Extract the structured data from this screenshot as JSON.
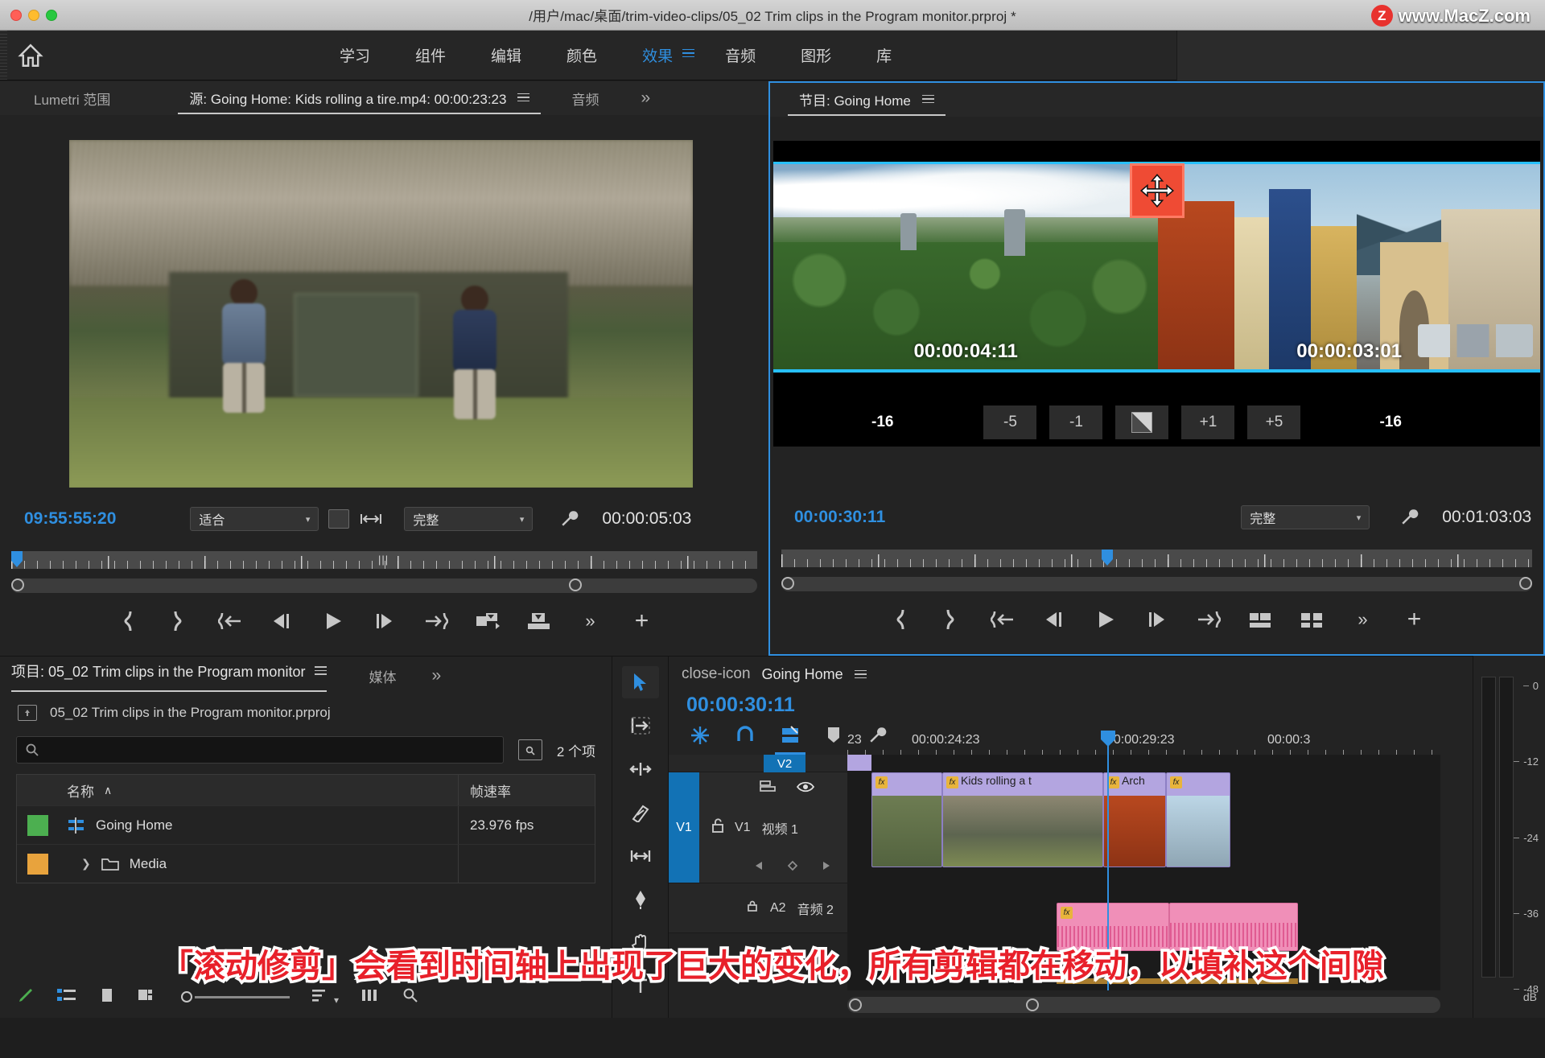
{
  "titlebar": {
    "path": "/用户/mac/桌面/trim-video-clips/05_02 Trim clips in the Program monitor.prproj *"
  },
  "watermark": {
    "badge": "Z",
    "text": "www.MacZ.com"
  },
  "workspace": {
    "home_icon": "home-icon",
    "items": [
      {
        "label": "学习",
        "active": false
      },
      {
        "label": "组件",
        "active": false
      },
      {
        "label": "编辑",
        "active": false
      },
      {
        "label": "颜色",
        "active": false
      },
      {
        "label": "效果",
        "active": true
      },
      {
        "label": "音频",
        "active": false
      },
      {
        "label": "图形",
        "active": false
      },
      {
        "label": "库",
        "active": false
      }
    ],
    "more": "»"
  },
  "source": {
    "tabs": [
      {
        "label": "Lumetri 范围",
        "active": false
      },
      {
        "label": "源: Going Home: Kids rolling a tire.mp4: 00:00:23:23",
        "active": true
      },
      {
        "label": "音频",
        "active": false
      }
    ],
    "more": "»",
    "playhead_timecode": "09:55:55:20",
    "duration_timecode": "00:00:05:03",
    "fit_select": "适合",
    "quality_select": "完整",
    "wrench_icon": "wrench-icon",
    "export_icon": "export-frame-icon"
  },
  "program": {
    "tab": "节目: Going Home",
    "left_timecode": "00:00:04:11",
    "right_timecode": "00:00:03:01",
    "trim_buttons": [
      {
        "label": "-16",
        "type": "text"
      },
      {
        "label": "-5",
        "type": "button"
      },
      {
        "label": "-1",
        "type": "button"
      },
      {
        "label": "",
        "type": "split"
      },
      {
        "label": "+1",
        "type": "button"
      },
      {
        "label": "+5",
        "type": "button"
      },
      {
        "label": "-16",
        "type": "text"
      }
    ],
    "playhead_timecode": "00:00:30:11",
    "duration_timecode": "00:01:03:03",
    "quality_select": "完整"
  },
  "project": {
    "tabs": [
      {
        "label": "项目: 05_02 Trim clips in the Program monitor",
        "active": true
      },
      {
        "label": "媒体",
        "active": false
      }
    ],
    "more": "»",
    "path_label": "05_02 Trim clips in the Program monitor.prproj",
    "search_placeholder": "",
    "item_count": "2 个项",
    "columns": [
      "名称",
      "帧速率"
    ],
    "sort_indicator": "∧",
    "rows": [
      {
        "color": "#4caf50",
        "icon": "sequence-icon",
        "name": "Going Home",
        "framerate": "23.976 fps"
      },
      {
        "color": "#e8a33d",
        "icon": "folder-icon",
        "name": "Media",
        "framerate": ""
      }
    ]
  },
  "tools": [
    {
      "name": "selection-tool",
      "icon": "arrow-icon",
      "active": true
    },
    {
      "name": "track-select-tool",
      "icon": "track-select-icon",
      "active": false
    },
    {
      "name": "ripple-edit-tool",
      "icon": "ripple-icon",
      "active": false
    },
    {
      "name": "razor-tool",
      "icon": "razor-icon",
      "active": false
    },
    {
      "name": "slip-tool",
      "icon": "slip-icon",
      "active": false
    },
    {
      "name": "pen-tool",
      "icon": "pen-icon",
      "active": false
    },
    {
      "name": "hand-tool",
      "icon": "hand-icon",
      "active": false
    },
    {
      "name": "type-tool",
      "icon": "type-icon",
      "active": false
    }
  ],
  "timeline": {
    "tab": "Going Home",
    "close_icon": "close-icon",
    "timecode": "00:00:30:11",
    "tool_icons": [
      "snap-nested-icon",
      "magnet-icon",
      "linked-selection-icon",
      "marker-icon",
      "wrench-icon"
    ],
    "ruler_labels": [
      "23",
      "00:00:24:23",
      "00:00:29:23",
      "00:00:3"
    ],
    "tracks": [
      {
        "badge": "V2",
        "name": "V1",
        "label": "视频 1",
        "lock": "unlock-icon",
        "eye": "eye-icon",
        "sync": "sync-icon"
      },
      {
        "badge": "A2",
        "name": "A2",
        "label": "音频 2",
        "lock": "lock-icon"
      }
    ],
    "clips": [
      {
        "track": "V1",
        "name": "",
        "type": "video"
      },
      {
        "track": "V1",
        "name": "Kids rolling a t",
        "type": "video"
      },
      {
        "track": "V1",
        "name": "Arch",
        "type": "video"
      },
      {
        "track": "A2",
        "name": "",
        "type": "audio"
      }
    ]
  },
  "meters": {
    "labels": [
      "0",
      "-12",
      "-24",
      "-36",
      "-48"
    ],
    "unit": "dB"
  },
  "caption": {
    "text": "「滚动修剪」会看到时间轴上出现了巨大的变化，所有剪辑都在移动，以填补这个间隙"
  }
}
